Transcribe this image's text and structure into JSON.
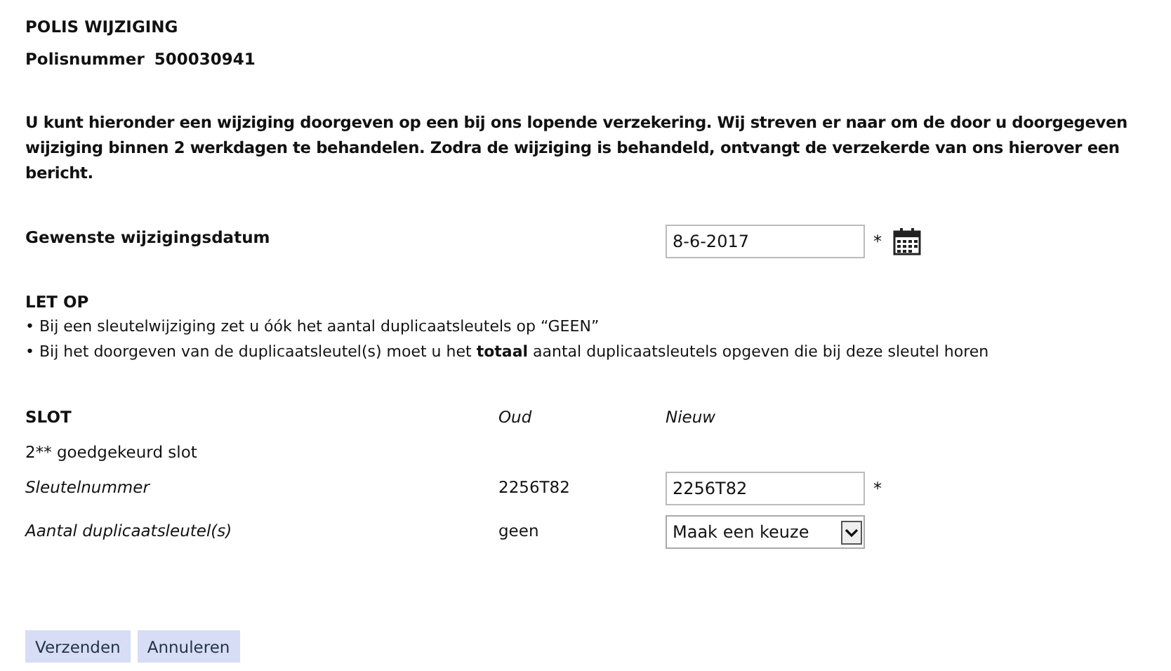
{
  "title": "POLIS WIJZIGING",
  "policy": {
    "label": "Polisnummer",
    "value": "500030941"
  },
  "intro": "U kunt hieronder een wijziging doorgeven op een bij ons lopende verzekering. Wij streven er naar om de door u doorgegeven wijziging binnen 2 werkdagen te behandelen. Zodra de wijziging is behandeld, ontvangt de verzekerde van ons hierover een bericht.",
  "date_field": {
    "label": "Gewenste wijzigingsdatum",
    "value": "8-6-2017",
    "required_mark": "*"
  },
  "notice": {
    "heading": "LET OP",
    "lines": [
      "• Bij een sleutelwijziging zet u óók het aantal duplicaatsleutels op “GEEN”",
      "• Bij het doorgeven van de duplicaatsleutel(s) moet u het **totaal** aantal duplicaatsleutels opgeven die bij deze sleutel horen"
    ]
  },
  "slot": {
    "heading": "SLOT",
    "column_old": "Oud",
    "column_new": "Nieuw",
    "subtitle": "2** goedgekeurd slot",
    "rows": [
      {
        "label": "Sleutelnummer",
        "old": "2256T82",
        "kind": "text",
        "value": "2256T82",
        "required_mark": "*"
      },
      {
        "label": "Aantal duplicaatsleutel(s)",
        "old": "geen",
        "kind": "select",
        "value": "Maak een keuze"
      }
    ]
  },
  "buttons": [
    "Verzenden",
    "Annuleren"
  ]
}
